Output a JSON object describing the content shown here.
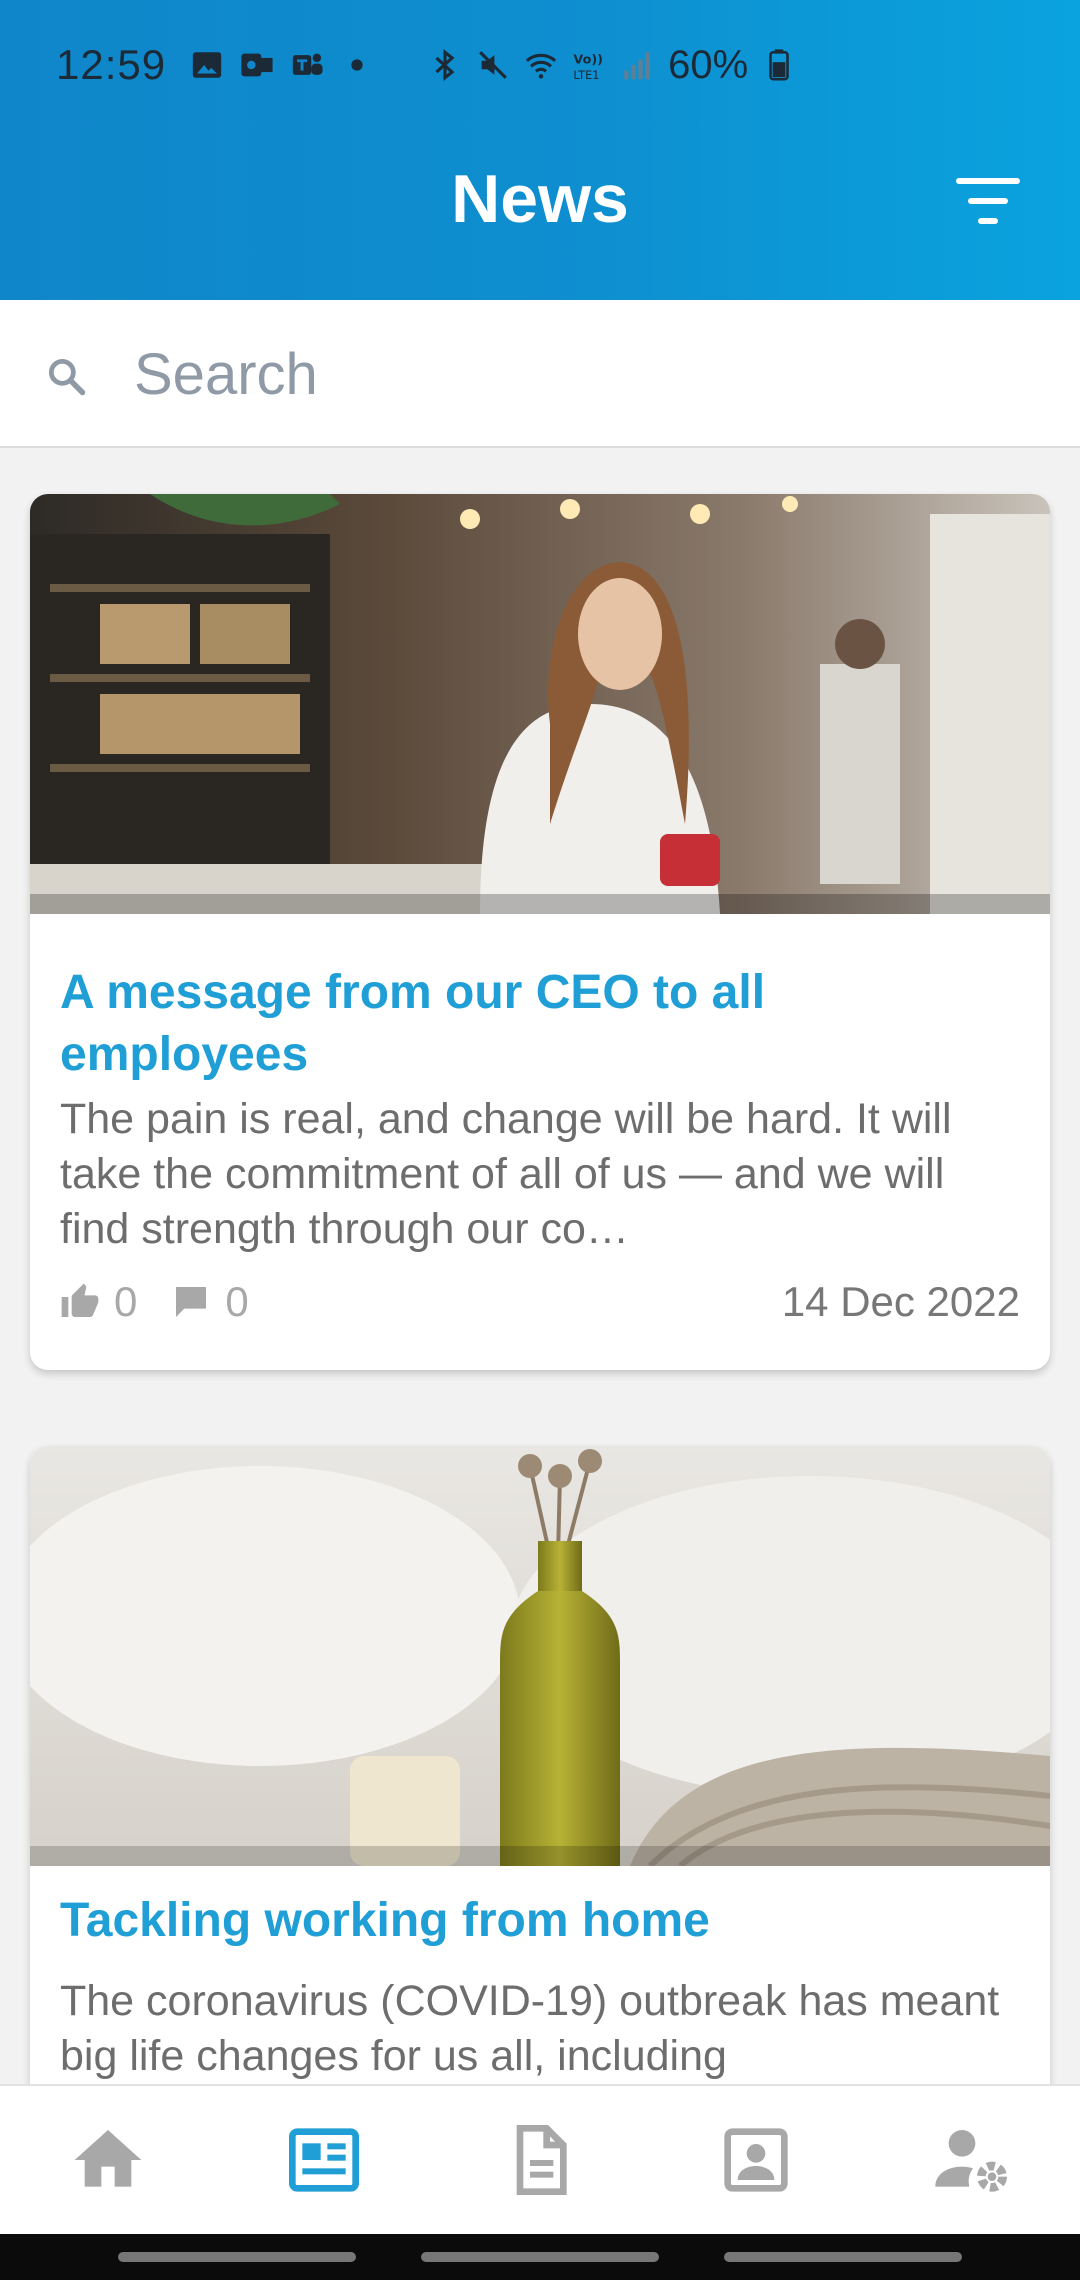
{
  "status_bar": {
    "time": "12:59",
    "battery": "60%",
    "network": "Vo)) LTE1"
  },
  "header": {
    "title": "News",
    "filter_icon": "filter-icon"
  },
  "search": {
    "placeholder": "Search",
    "value": ""
  },
  "articles": [
    {
      "title": "A message from our CEO to all employees",
      "excerpt": "The pain is real, and change will be hard. It will take the commitment of all of us — and we will find strength through our co…",
      "likes": "0",
      "comments": "0",
      "date": "14 Dec 2022",
      "image": "woman-holding-coffee-cup-in-cafe"
    },
    {
      "title": "Tackling working from home",
      "excerpt": "The coronavirus (COVID-19) outbreak has meant big life changes for us all, including",
      "image": "vase-with-flowers-on-blanket"
    }
  ],
  "bottom_nav": {
    "items": [
      {
        "icon": "home-icon",
        "active": false
      },
      {
        "icon": "news-icon",
        "active": true
      },
      {
        "icon": "document-icon",
        "active": false
      },
      {
        "icon": "contact-card-icon",
        "active": false
      },
      {
        "icon": "user-settings-icon",
        "active": false
      }
    ]
  },
  "colors": {
    "header_gradient_start": "#0f86c9",
    "header_gradient_end": "#0aa3df",
    "accent": "#1f9fd5",
    "text_muted": "#6d6d6d",
    "icon_inactive": "#a8a8a8",
    "icon_active": "#1f9fd5"
  }
}
